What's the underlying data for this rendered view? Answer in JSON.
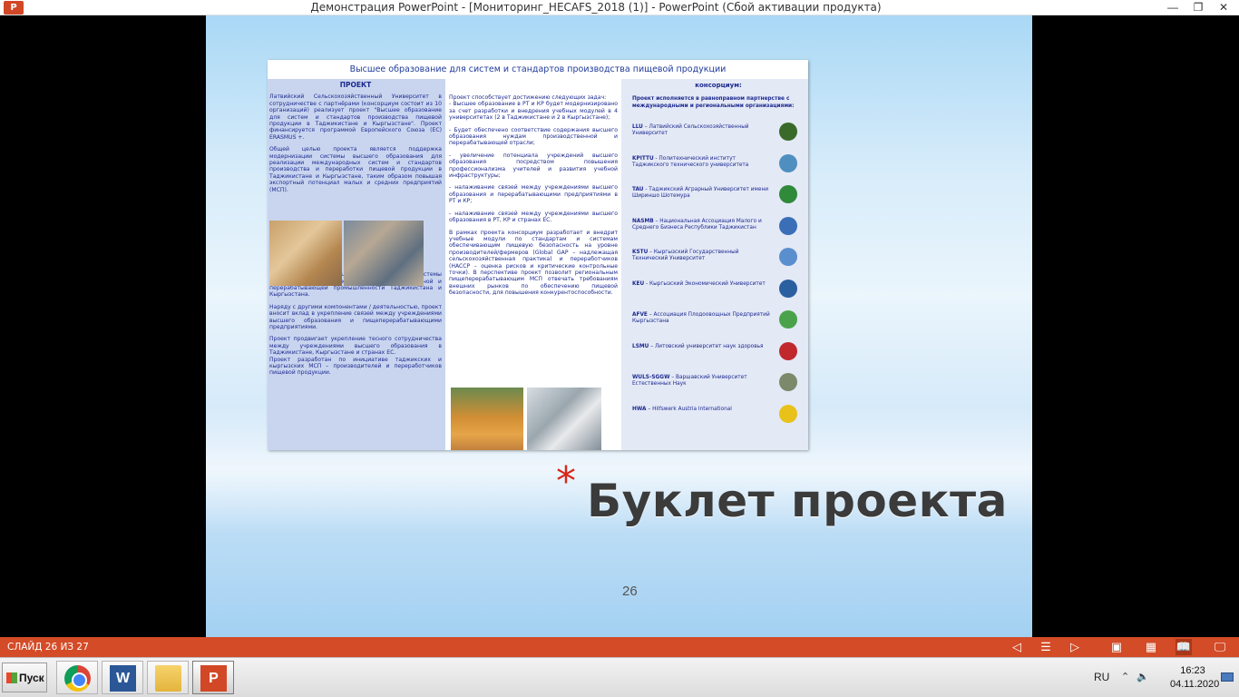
{
  "window": {
    "app_icon": "P",
    "title": "Демонстрация PowerPoint - [Мониторинг_HECAFS_2018 (1)] - PowerPoint (Сбой активации продукта)",
    "minimize": "—",
    "restore": "❐",
    "close": "✕"
  },
  "slide": {
    "brochure": {
      "header": "Высшее образование для систем и стандартов производства пищевой продукции",
      "col1": {
        "heading": "ПРОЕКТ",
        "p1": "Латвийский Сельскохозяйственный Университет в сотрудничестве с партнёрами (консорциум состоит из 10 организаций) реализует проект \"Высшее образование для систем и стандартов производства пищевой продукции в Таджикистане и Кыргызстане\". Проект финансируется программой Европейского Союза (ЕС) ERASMUS +.",
        "p2": "Общей целью проекта является поддержка модернизации системы высшего образования для реализации международных систем и стандартов производства и переработки пищевой продукции в Таджикистане и Кыргызстане, таким образом повышая экспортный потенциал малых и средних предприятий (МСП).",
        "p3": "Проектная команда нацелена на приведение системы высшего образования к нуждам производственной и перерабатывающей промышленности Таджикистана и Кыргызстана.",
        "p4": "Наряду с другими компонентами / деятельностью, проект вносит вклад в укрепление связей между учреждениями высшего образования и пищеперерабатывающими предприятиями.",
        "p5": "Проект продвигает укрепление тесного сотрудничества между учреждениями высшего образования в Таджикистане, Кыргызстане и странах ЕС.",
        "p6": "Проект разработан по инициативе таджикских и кыргызских МСП – производителей и переработчиков пищевой продукции."
      },
      "col2": {
        "p1": "Проект способствует достижению следующих задач:\n- Высшее образование в РТ и КР будет модернизировано за счет разработки и внедрения учебных модулей в 4 университетах (2 в Таджикистане и 2 в Кыргызстане);",
        "p2": "- Будет обеспечено соответствие содержания высшего образования нуждам производственной и перерабатывающей отрасли;",
        "p3": "- увеличение потенциала учреждений высшего образования посредством повышения профессионализма учителей и развития учебной инфраструктуры;",
        "p4": "- налаживание связей между учреждениями высшего образования и перерабатывающими предприятиями в РТ и КР;",
        "p5": "- налаживание связей между учреждениями высшего образования в РТ, КР и странах ЕС.",
        "p6": "В рамках проекта консорциум разработает и внедрит учебные модули по стандартам и системам обеспечивающим пищевую безопасность на уровне производителей/фермеров (Global GAP – надлежащая сельскохозяйственная практика) и переработчиков (HACCP – оценка рисков и критические контрольные точки). В перспективе проект позволит региональным пищеперерабатывающим МСП отвечать требованиям внешних рынков по обеспечению пищевой безопасности, для повышения конкурентоспособности."
      },
      "col3": {
        "heading": "консорциум:",
        "intro": "Проект исполняется в равноправном партнерстве с международными и региональными организациями:",
        "partners": [
          {
            "abbr": "LLU",
            "name": " – Латвийский Сельскохозяйственный Университет",
            "logo_color": "#3a6a2a"
          },
          {
            "abbr": "KPITTU",
            "name": " - Политехнический институт Таджикского технического университета",
            "logo_color": "#4f8fc0"
          },
          {
            "abbr": "TAU",
            "name": " - Таджикский Аграрный Университет имени Шириншо Шотемура",
            "logo_color": "#2f8a3a"
          },
          {
            "abbr": "NASMB",
            "name": " – Национальная Ассоциация Малого и Среднего Бизнеса Республики Таджикистан",
            "logo_color": "#3a6fb8"
          },
          {
            "abbr": "KSTU",
            "name": " – Кыргызский Государственный Технический Университет",
            "logo_color": "#5a8fcf"
          },
          {
            "abbr": "KEU",
            "name": " - Кыргызский Экономический Университет",
            "logo_color": "#2a5fa0"
          },
          {
            "abbr": "AFVE",
            "name": " – Ассоциация Плодоовощных Предприятий Кыргызстана",
            "logo_color": "#4aa34a"
          },
          {
            "abbr": "LSMU",
            "name": " – Литовский университет наук здоровья",
            "logo_color": "#c0282d"
          },
          {
            "abbr": "WULS-SGGW",
            "name": " – Варшавский Университет Естественных Наук",
            "logo_color": "#7a8a6a"
          },
          {
            "abbr": "HWA",
            "name": " – Hilfswerk Austria International",
            "logo_color": "#e8c21a"
          }
        ]
      }
    },
    "bullet": "*",
    "title": "Буклет проекта",
    "number": "26"
  },
  "statusbar": {
    "slide_count": "СЛАЙД 26 ИЗ 27",
    "prev": "◁",
    "slides": "☰",
    "next": "▷",
    "normal": "▣",
    "sorter": "▦",
    "reading": "📖",
    "presenter": "🖵"
  },
  "taskbar": {
    "start_label": "Пуск",
    "word_letter": "W",
    "ppt_letter": "P",
    "lang": "RU",
    "time": "16:23",
    "date": "04.11.2020",
    "up_arrow": "⌃",
    "volume": "🔈"
  }
}
